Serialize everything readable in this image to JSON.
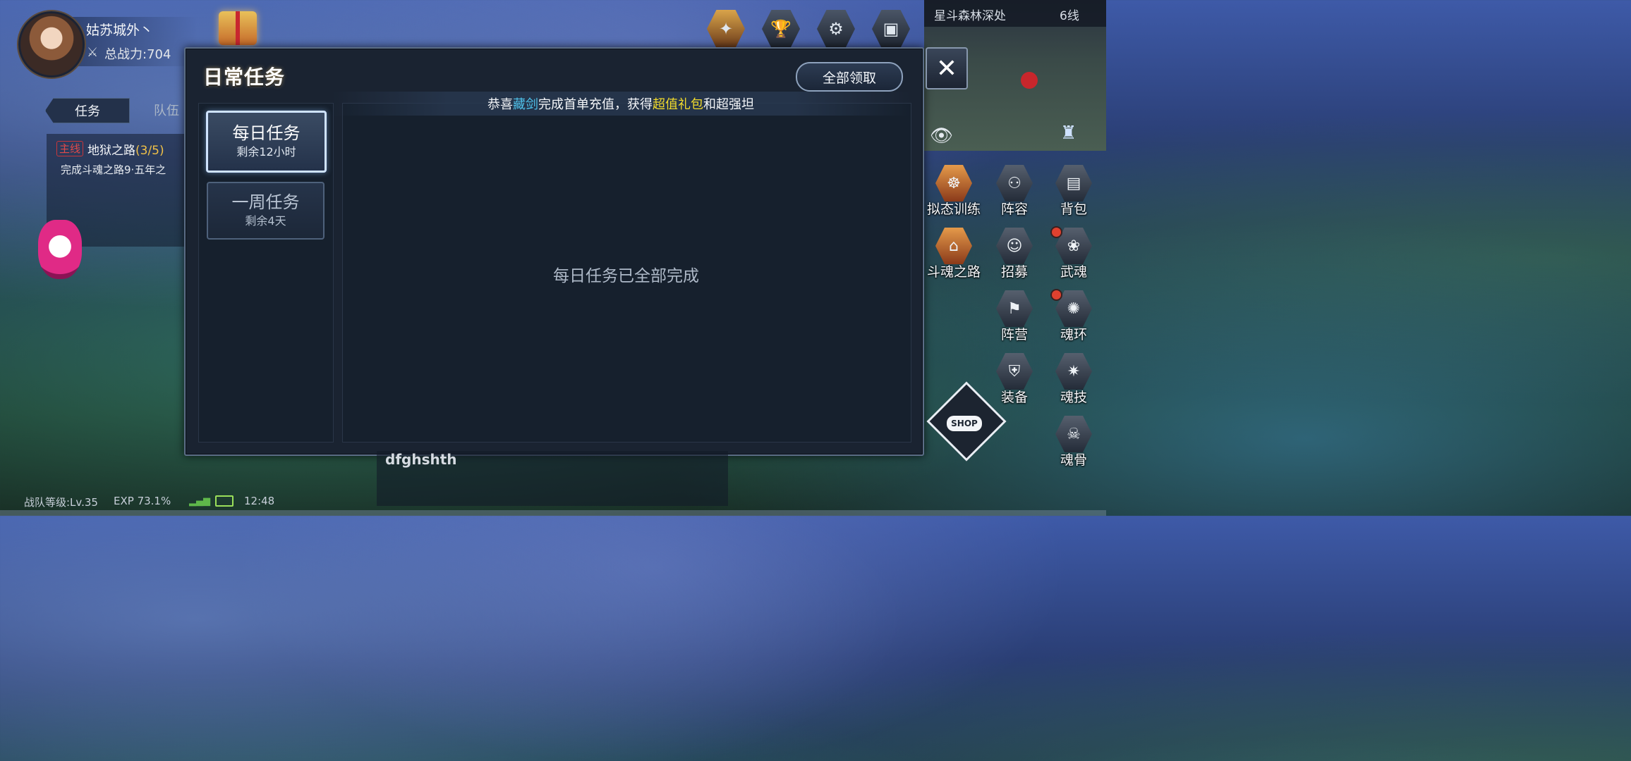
{
  "player": {
    "name": "姑苏城外丶",
    "power_label": "总战力:704"
  },
  "left_panel": {
    "tabs": [
      "任务",
      "队伍"
    ],
    "quest": {
      "tag": "主线",
      "title": "地狱之路",
      "progress": "(3/5)",
      "description": "完成斗魂之路9·五年之"
    }
  },
  "dialog": {
    "title": "日常任务",
    "claim_all": "全部领取",
    "marquee": {
      "prefix": "恭喜",
      "player": "藏剑",
      "middle": "完成首单充值，获得",
      "reward": "超值礼包",
      "suffix": "和超强坦"
    },
    "tabs": [
      {
        "name": "每日任务",
        "remaining": "剩余12小时",
        "selected": true
      },
      {
        "name": "一周任务",
        "remaining": "剩余4天",
        "selected": false
      }
    ],
    "empty_message": "每日任务已全部完成",
    "close": "✕"
  },
  "minimap": {
    "location": "星斗森林深处",
    "line": "6线"
  },
  "right_menu": [
    {
      "label": "拟态训练",
      "icon": "meditation-icon",
      "badge": false
    },
    {
      "label": "阵容",
      "icon": "lineup-icon",
      "badge": false
    },
    {
      "label": "背包",
      "icon": "backpack-icon",
      "badge": false
    },
    {
      "label": "斗魂之路",
      "icon": "gate-icon",
      "badge": false
    },
    {
      "label": "招募",
      "icon": "recruit-icon",
      "badge": false
    },
    {
      "label": "武魂",
      "icon": "martial-soul-icon",
      "badge": true
    },
    {
      "label": "阵营",
      "icon": "camp-icon",
      "badge": false
    },
    {
      "label": "魂环",
      "icon": "soul-ring-icon",
      "badge": true
    },
    {
      "label": "装备",
      "icon": "equipment-icon",
      "badge": false
    },
    {
      "label": "魂技",
      "icon": "soul-skill-icon",
      "badge": false
    },
    {
      "label": "魂骨",
      "icon": "soul-bone-icon",
      "badge": false
    }
  ],
  "shop_label": "SHOP",
  "bottom": {
    "chat_text": "dfghshth",
    "team_level": "战队等级:Lv.35",
    "exp": "EXP 73.1%",
    "time": "12:48"
  },
  "icons": {
    "close": "close-icon",
    "eye": "eye-icon",
    "gift": "gift-icon"
  }
}
